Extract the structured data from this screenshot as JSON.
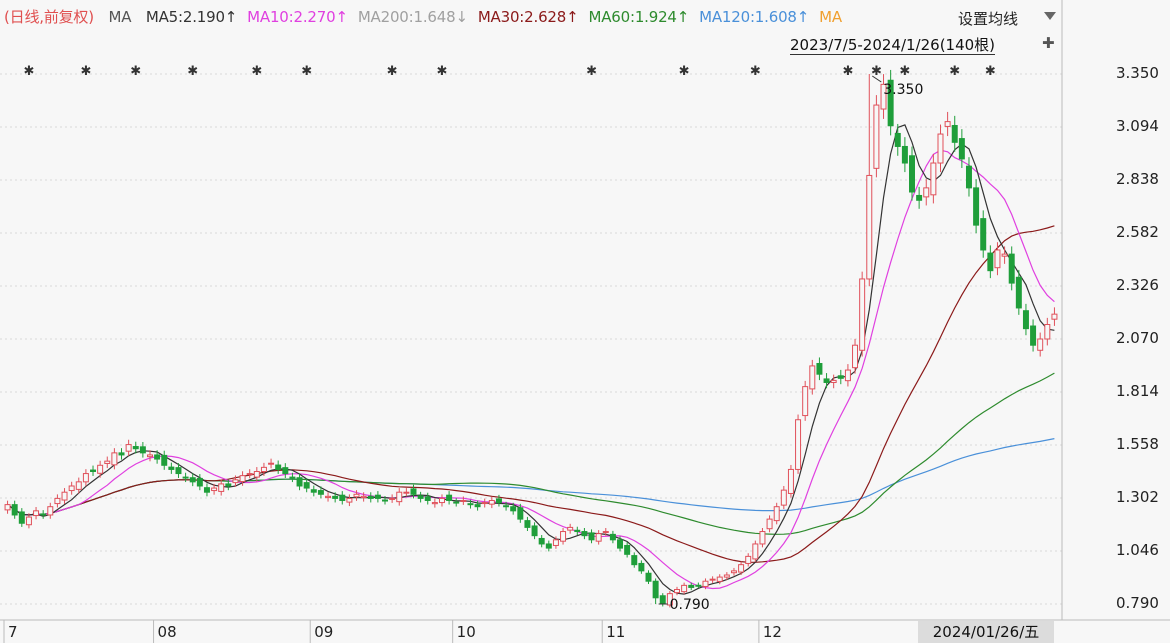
{
  "legend": {
    "mode": "(日线,前复权)",
    "ma": "MA",
    "items": [
      {
        "text": "MA5:2.190↑",
        "color": "#333333"
      },
      {
        "text": "MA10:2.270↑",
        "color": "#e040e0"
      },
      {
        "text": "MA200:1.648↓",
        "color": "#a0a0a0"
      },
      {
        "text": "MA30:2.628↑",
        "color": "#8b1a1a"
      },
      {
        "text": "MA60:1.924↑",
        "color": "#2e8b2e"
      },
      {
        "text": "MA120:1.608↑",
        "color": "#4a90d9"
      },
      {
        "text": "MA",
        "color": "#f0a030"
      }
    ]
  },
  "settings_label": "设置均线",
  "date_range": "2023/7/5-2024/1/26(140根)",
  "pin_icon": "✚",
  "cursor_date": "2024/01/26/五",
  "colors": {
    "up": "#e0505a",
    "down": "#1f9e3a",
    "grid": "#d8d8d8",
    "axis": "#bbbbbb"
  },
  "chart_data": {
    "type": "candlestick",
    "y_ticks": [
      "3.350",
      "3.094",
      "2.838",
      "2.582",
      "2.326",
      "2.070",
      "1.814",
      "1.558",
      "1.302",
      "1.046",
      "0.790"
    ],
    "ylim": [
      0.79,
      3.35
    ],
    "x_ticks": [
      "7",
      "08",
      "09",
      "10",
      "11",
      "12"
    ],
    "x_tick_index": [
      0,
      21,
      43,
      63,
      84,
      106
    ],
    "high_annotation": {
      "index": 121,
      "value": 3.35,
      "label": "3.350"
    },
    "low_annotation": {
      "index": 91,
      "value": 0.79,
      "label": "0.790"
    },
    "marker_indexes": [
      3,
      11,
      18,
      26,
      35,
      42,
      54,
      61,
      82,
      95,
      105,
      118,
      122,
      126,
      133,
      138
    ],
    "closes": [
      1.27,
      1.22,
      1.18,
      1.21,
      1.24,
      1.22,
      1.26,
      1.3,
      1.33,
      1.36,
      1.38,
      1.42,
      1.43,
      1.46,
      1.48,
      1.52,
      1.51,
      1.56,
      1.54,
      1.52,
      1.51,
      1.49,
      1.46,
      1.44,
      1.42,
      1.4,
      1.38,
      1.36,
      1.33,
      1.35,
      1.37,
      1.36,
      1.39,
      1.41,
      1.42,
      1.43,
      1.45,
      1.47,
      1.44,
      1.42,
      1.4,
      1.36,
      1.35,
      1.33,
      1.32,
      1.31,
      1.3,
      1.29,
      1.3,
      1.32,
      1.31,
      1.3,
      1.3,
      1.29,
      1.3,
      1.33,
      1.33,
      1.32,
      1.3,
      1.29,
      1.28,
      1.3,
      1.29,
      1.28,
      1.29,
      1.27,
      1.26,
      1.28,
      1.29,
      1.28,
      1.26,
      1.24,
      1.2,
      1.16,
      1.12,
      1.08,
      1.06,
      1.1,
      1.14,
      1.16,
      1.14,
      1.12,
      1.1,
      1.13,
      1.14,
      1.1,
      1.06,
      1.03,
      0.98,
      0.95,
      0.9,
      0.82,
      0.79,
      0.84,
      0.86,
      0.88,
      0.87,
      0.88,
      0.9,
      0.91,
      0.92,
      0.93,
      0.95,
      0.98,
      1.02,
      1.08,
      1.14,
      1.2,
      1.26,
      1.34,
      1.44,
      1.68,
      1.84,
      1.94,
      1.9,
      1.86,
      1.87,
      1.88,
      1.92,
      2.04,
      2.36,
      2.86,
      3.2,
      3.3,
      3.1,
      3.0,
      2.92,
      2.78,
      2.74,
      2.8,
      2.92,
      3.06,
      3.12,
      3.02,
      2.94,
      2.8,
      2.62,
      2.5,
      2.4,
      2.5,
      2.48,
      2.34,
      2.22,
      2.12,
      2.04,
      2.07,
      2.14,
      2.19
    ]
  }
}
